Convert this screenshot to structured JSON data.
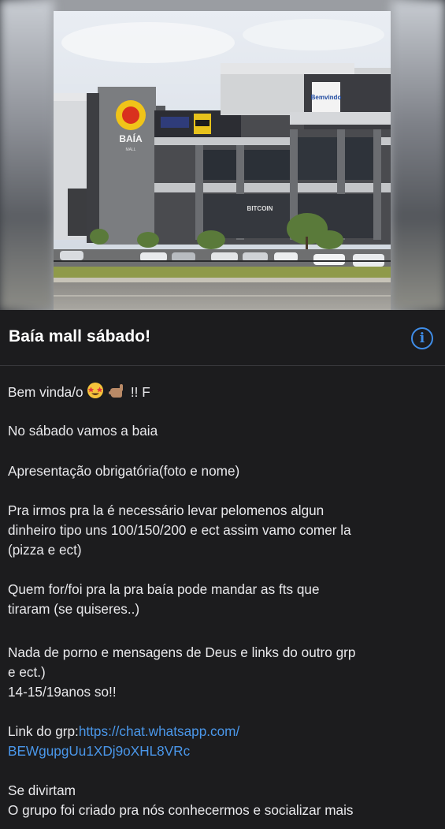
{
  "group": {
    "name": "Baía mall sábado!",
    "info_icon": "info-icon"
  },
  "photo": {
    "sign_text": "BAÍA",
    "sign_subtext": "MALL",
    "store_sign": "Bemvindo",
    "logo_icon": "mall-logo-icon"
  },
  "description": {
    "greeting_text": "Bem vinda/o",
    "greeting_emojis": [
      "star-struck-emoji",
      "call-me-hand-emoji"
    ],
    "greeting_suffix": "!! F",
    "line_saturday": "No sábado vamos a baia",
    "line_intro": "Apresentação obrigatória(foto e nome)",
    "money_lines": [
      "Pra irmos pra la é necessário levar pelomenos algun",
      "dinheiro tipo uns 100/150/200 e ect assim vamo comer la",
      "(pizza e ect)"
    ],
    "photos_lines": [
      "Quem for/foi pra la pra baía pode mandar as fts que",
      "tiraram (se quiseres..)"
    ],
    "rules_lines": [
      "Nada de porno e mensagens de Deus e links do outro grp",
      "e ect.)",
      "14-15/19anos so!!"
    ],
    "link_label": "Link do grp:",
    "link_url_part1": "https://chat.whatsapp.com/",
    "link_url_part2": "BEWgupgUu1XDj9oXHL8VRc",
    "closing_lines": [
      "Se divirtam",
      "O grupo foi criado pra nós  conhecermos e socializar mais"
    ]
  }
}
